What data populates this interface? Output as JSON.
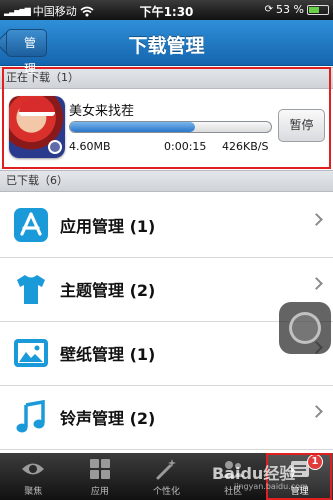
{
  "status_bar": {
    "carrier": "中国移动",
    "time": "下午1:30",
    "battery": "53 %"
  },
  "nav": {
    "back_label": "管理",
    "title": "下载管理"
  },
  "downloading": {
    "header": "正在下载（1）",
    "item": {
      "name": "美女来找茬",
      "size": "4.60MB",
      "elapsed": "0:00:15",
      "speed": "426KB/S",
      "progress": 0.62,
      "pause_label": "暂停"
    }
  },
  "downloaded": {
    "header": "已下载（6）"
  },
  "manage_items": [
    {
      "label": "应用管理 (1)",
      "icon": "app-store-icon"
    },
    {
      "label": "主题管理 (2)",
      "icon": "tshirt-icon"
    },
    {
      "label": "壁纸管理 (1)",
      "icon": "picture-icon"
    },
    {
      "label": "铃声管理 (2)",
      "icon": "music-note-icon"
    }
  ],
  "tabs": [
    {
      "label": "聚焦",
      "icon": "eye-icon"
    },
    {
      "label": "应用",
      "icon": "grid-icon"
    },
    {
      "label": "个性化",
      "icon": "magic-wand-icon"
    },
    {
      "label": "社区",
      "icon": "community-icon"
    },
    {
      "label": "管理",
      "icon": "manage-icon",
      "badge": "1"
    }
  ],
  "watermark": {
    "text": "Baidu经验",
    "sub": "jingyan.baidu.com"
  },
  "colors": {
    "nav_blue": "#1e75c2",
    "icon_blue": "#1a9ad8",
    "highlight_red": "#e02020",
    "badge_red": "#e23b3b"
  }
}
